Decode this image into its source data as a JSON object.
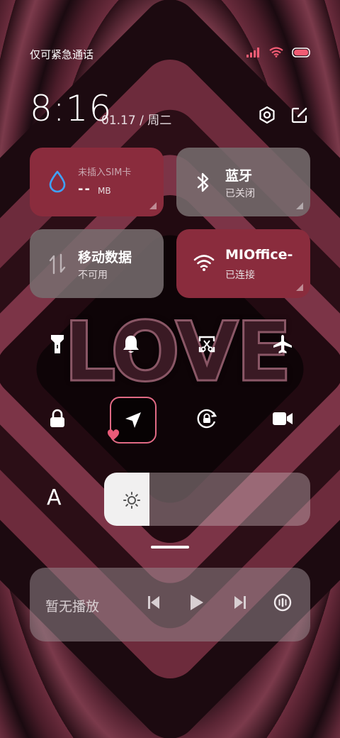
{
  "status_bar": {
    "carrier_text": "仅可紧急通话",
    "icons": [
      "signal-icon",
      "wifi-icon",
      "battery-icon"
    ],
    "battery_color": "#f25c74"
  },
  "header": {
    "time": "8:16",
    "date": "01.17 / 周二"
  },
  "tiles": {
    "sim": {
      "title": "未插入SIM卡",
      "data_value": "--",
      "data_unit": "MB",
      "icon": "droplet-icon"
    },
    "bluetooth": {
      "title": "蓝牙",
      "status": "已关闭",
      "icon": "bluetooth-icon"
    },
    "mobile_data": {
      "title": "移动数据",
      "status": "不可用",
      "icon": "data-arrows-icon"
    },
    "wifi": {
      "title": "MIOffice-",
      "status": "已连接",
      "icon": "wifi-icon"
    }
  },
  "quick_toggles": [
    "flashlight-icon",
    "bell-icon",
    "screenshot-icon",
    "airplane-icon",
    "lock-icon",
    "location-icon",
    "rotation-lock-icon",
    "video-camera-icon"
  ],
  "brightness": {
    "label": "A",
    "level": 0.22
  },
  "media": {
    "status_text": "暂无播放"
  },
  "colors": {
    "accent": "#8a2c3d",
    "location_border": "#e06a84"
  }
}
